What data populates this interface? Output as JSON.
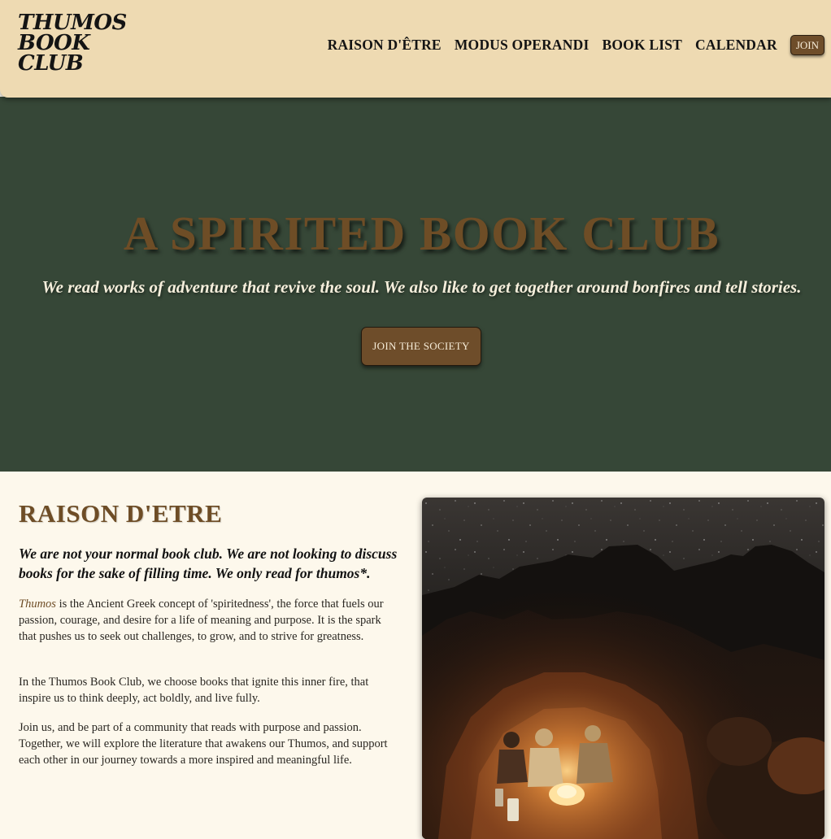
{
  "header": {
    "logo_lines": [
      "THUMOS",
      "BOOK",
      "CLUB"
    ],
    "nav": [
      {
        "label": "RAISON D'ÊTRE"
      },
      {
        "label": "MODUS OPERANDI"
      },
      {
        "label": "BOOK LIST"
      },
      {
        "label": "CALENDAR"
      }
    ],
    "join_label": "JOIN"
  },
  "hero": {
    "title": "A SPIRITED BOOK CLUB",
    "subtitle": "We read works of adventure that revive the soul. We also like to get together around bonfires and tell stories.",
    "cta_label": "JOIN THE SOCIETY"
  },
  "raison": {
    "heading": "RAISON D'ETRE",
    "lead": "We are not your normal book club. We are not looking to discuss books for the sake of filling time. We only read for thumos*.",
    "p1_term": "Thumos",
    "p1_rest": " is the Ancient Greek concept of 'spiritedness', the force that fuels our passion, courage, and desire for a life of meaning and purpose. It is the spark that pushes us to seek out challenges, to grow, and to strive for greatness.",
    "p2": "In the Thumos Book Club, we choose books that ignite this inner fire, that inspire us to think deeply, act boldly, and live fully.",
    "p3": "Join us, and be part of a community that reads with purpose and passion. Together, we will explore the literature that awakens our Thumos, and support each other in our journey towards a more inspired and meaningful life."
  },
  "colors": {
    "header_bg": "#eedab2",
    "hero_bg": "#364737",
    "accent_brown": "#6e4d26",
    "page_bg": "#fdf8ec"
  }
}
